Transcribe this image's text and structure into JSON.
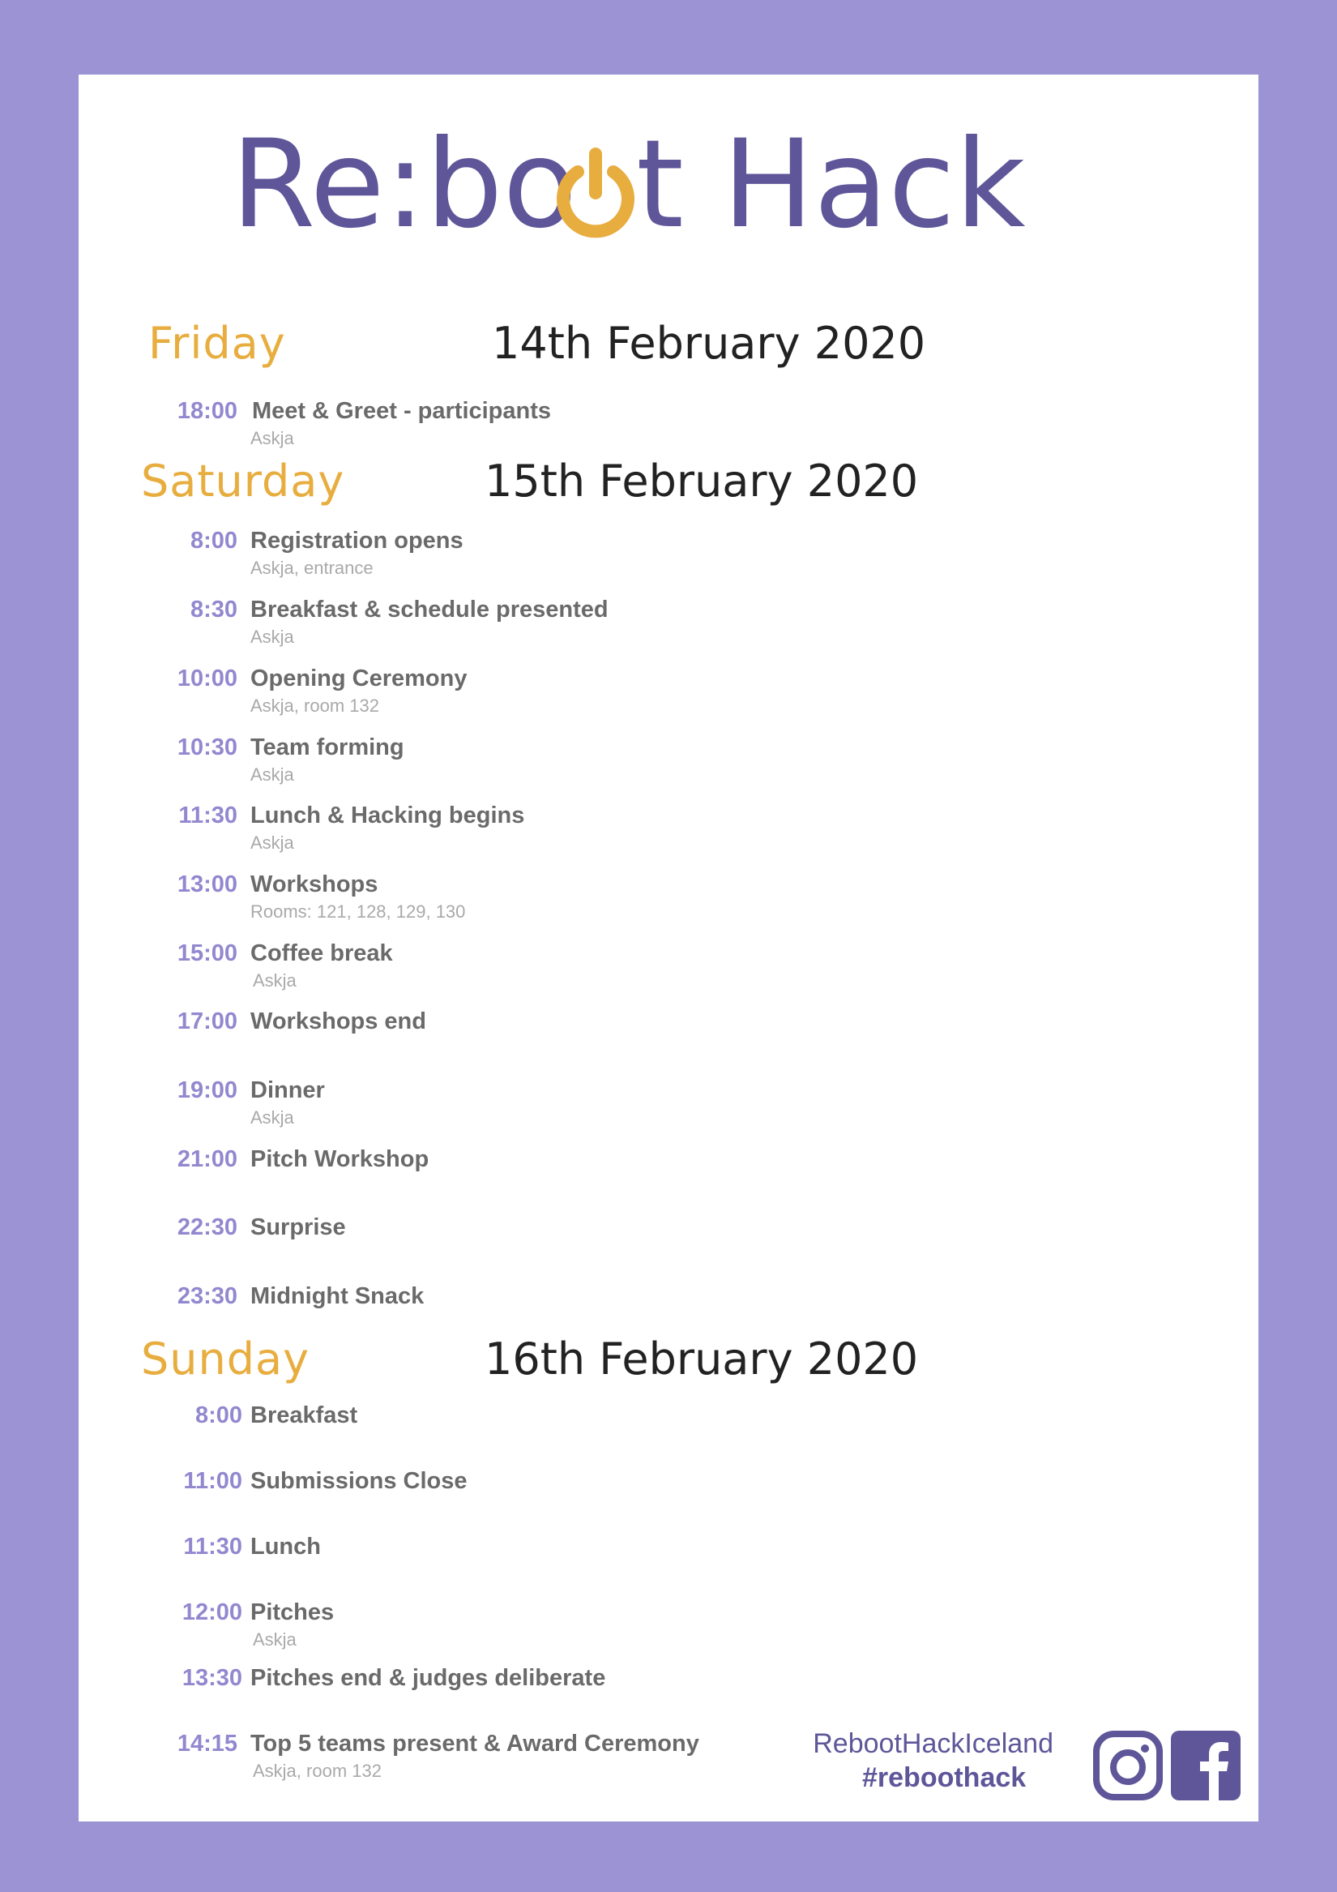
{
  "logo": {
    "text_start": "Re:bo",
    "text_end": "t Hack",
    "brand_color": "#5e5699",
    "accent_color": "#e8ad3f"
  },
  "days": [
    {
      "name": "Friday",
      "date": "14th February 2020",
      "events": [
        {
          "time": "18:00",
          "title": "Meet & Greet - participants",
          "location": "Askja"
        }
      ]
    },
    {
      "name": "Saturday",
      "date": "15th February 2020",
      "events": [
        {
          "time": "8:00",
          "title": "Registration opens",
          "location": "Askja, entrance"
        },
        {
          "time": "8:30",
          "title": "Breakfast & schedule presented",
          "location": "Askja"
        },
        {
          "time": "10:00",
          "title": "Opening Ceremony",
          "location": "Askja, room 132"
        },
        {
          "time": "10:30",
          "title": "Team forming",
          "location": "Askja"
        },
        {
          "time": "11:30",
          "title": "Lunch & Hacking begins",
          "location": "Askja"
        },
        {
          "time": "13:00",
          "title": "Workshops",
          "location": "Rooms: 121, 128, 129, 130"
        },
        {
          "time": "15:00",
          "title": "Coffee break",
          "location": "Askja"
        },
        {
          "time": "17:00",
          "title": "Workshops end",
          "location": ""
        },
        {
          "time": "19:00",
          "title": "Dinner",
          "location": "Askja"
        },
        {
          "time": "21:00",
          "title": "Pitch Workshop",
          "location": ""
        },
        {
          "time": "22:30",
          "title": "Surprise",
          "location": ""
        },
        {
          "time": "23:30",
          "title": "Midnight Snack",
          "location": ""
        }
      ]
    },
    {
      "name": "Sunday",
      "date": "16th February 2020",
      "events": [
        {
          "time": "8:00",
          "title": "Breakfast",
          "location": ""
        },
        {
          "time": "11:00",
          "title": "Submissions Close",
          "location": ""
        },
        {
          "time": "11:30",
          "title": "Lunch",
          "location": ""
        },
        {
          "time": "12:00",
          "title": "Pitches",
          "location": "Askja"
        },
        {
          "time": "13:30",
          "title": "Pitches end & judges deliberate",
          "location": ""
        },
        {
          "time": "14:15",
          "title": "Top 5 teams present & Award Ceremony",
          "location": "Askja, room 132"
        }
      ]
    }
  ],
  "footer": {
    "handle": "RebootHackIceland",
    "hashtag": "#reboothack",
    "icons": [
      "instagram-icon",
      "facebook-icon"
    ],
    "icon_color": "#5e5699"
  },
  "colors": {
    "background": "#9b93d4",
    "sheet": "#ffffff",
    "day_name": "#e8ad3f",
    "time": "#9288cf",
    "title": "#6a6a6a",
    "location": "#a9a9a9"
  }
}
